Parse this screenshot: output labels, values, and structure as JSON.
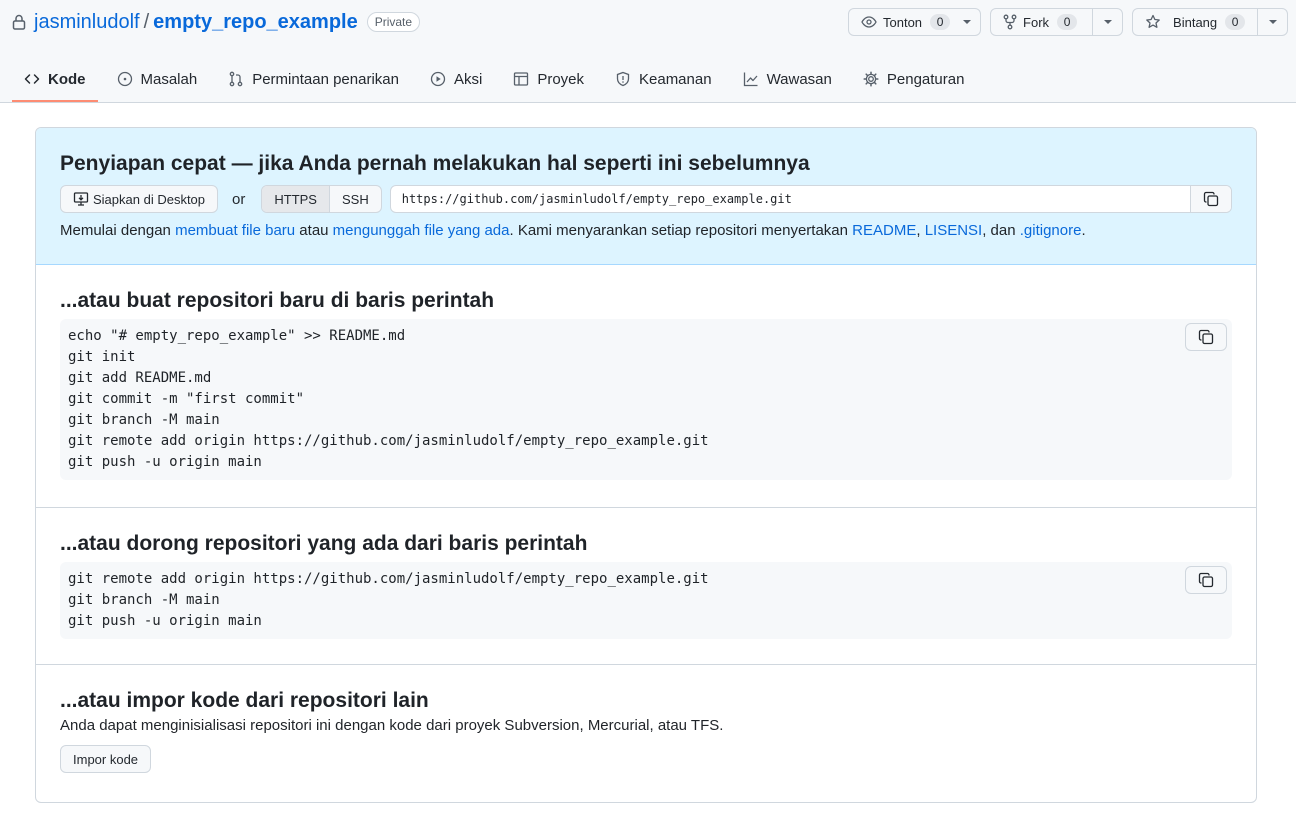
{
  "repo": {
    "owner": "jasminludolf",
    "separator": "/",
    "name": "empty_repo_example",
    "visibility": "Private"
  },
  "actions": {
    "watch": {
      "label": "Tonton",
      "count": "0",
      "icon": "eye-icon"
    },
    "fork": {
      "label": "Fork",
      "count": "0",
      "icon": "fork-icon"
    },
    "star": {
      "label": "Bintang",
      "count": "0",
      "icon": "star-icon"
    }
  },
  "tabs": [
    {
      "label": "Kode",
      "icon": "code-icon",
      "active": true
    },
    {
      "label": "Masalah",
      "icon": "issue-icon"
    },
    {
      "label": "Permintaan penarikan",
      "icon": "pull-request-icon"
    },
    {
      "label": "Aksi",
      "icon": "play-icon"
    },
    {
      "label": "Proyek",
      "icon": "table-icon"
    },
    {
      "label": "Keamanan",
      "icon": "shield-icon"
    },
    {
      "label": "Wawasan",
      "icon": "graph-icon"
    },
    {
      "label": "Pengaturan",
      "icon": "gear-icon"
    }
  ],
  "quick_setup": {
    "title": "Penyiapan cepat — jika Anda pernah melakukan hal seperti ini sebelumnya",
    "desktop_button": "Siapkan di Desktop",
    "or": "or",
    "https": "HTTPS",
    "ssh": "SSH",
    "clone_url": "https://github.com/jasminludolf/empty_repo_example.git",
    "hint": {
      "t1": "Memulai dengan ",
      "link_new_file": "membuat file baru",
      "t2": " atau ",
      "link_upload": "mengunggah file yang ada",
      "t3": ". Kami menyarankan setiap repositori menyertakan ",
      "link_readme": "README",
      "t4": ", ",
      "link_license": "LISENSI",
      "t5": ", dan ",
      "link_gitignore": ".gitignore",
      "t6": "."
    }
  },
  "new_repo": {
    "title": "...atau buat repositori baru di baris perintah",
    "code": "echo \"# empty_repo_example\" >> README.md\ngit init\ngit add README.md\ngit commit -m \"first commit\"\ngit branch -M main\ngit remote add origin https://github.com/jasminludolf/empty_repo_example.git\ngit push -u origin main"
  },
  "push_existing": {
    "title": "...atau dorong repositori yang ada dari baris perintah",
    "code": "git remote add origin https://github.com/jasminludolf/empty_repo_example.git\ngit branch -M main\ngit push -u origin main"
  },
  "import": {
    "title": "...atau impor kode dari repositori lain",
    "description": "Anda dapat menginisialisasi repositori ini dengan kode dari proyek Subversion, Mercurial, atau TFS.",
    "button": "Impor kode"
  },
  "colors": {
    "accent_link": "#0969da",
    "quick_bg": "#ddf4ff",
    "active_tab_underline": "#fd8c73"
  }
}
